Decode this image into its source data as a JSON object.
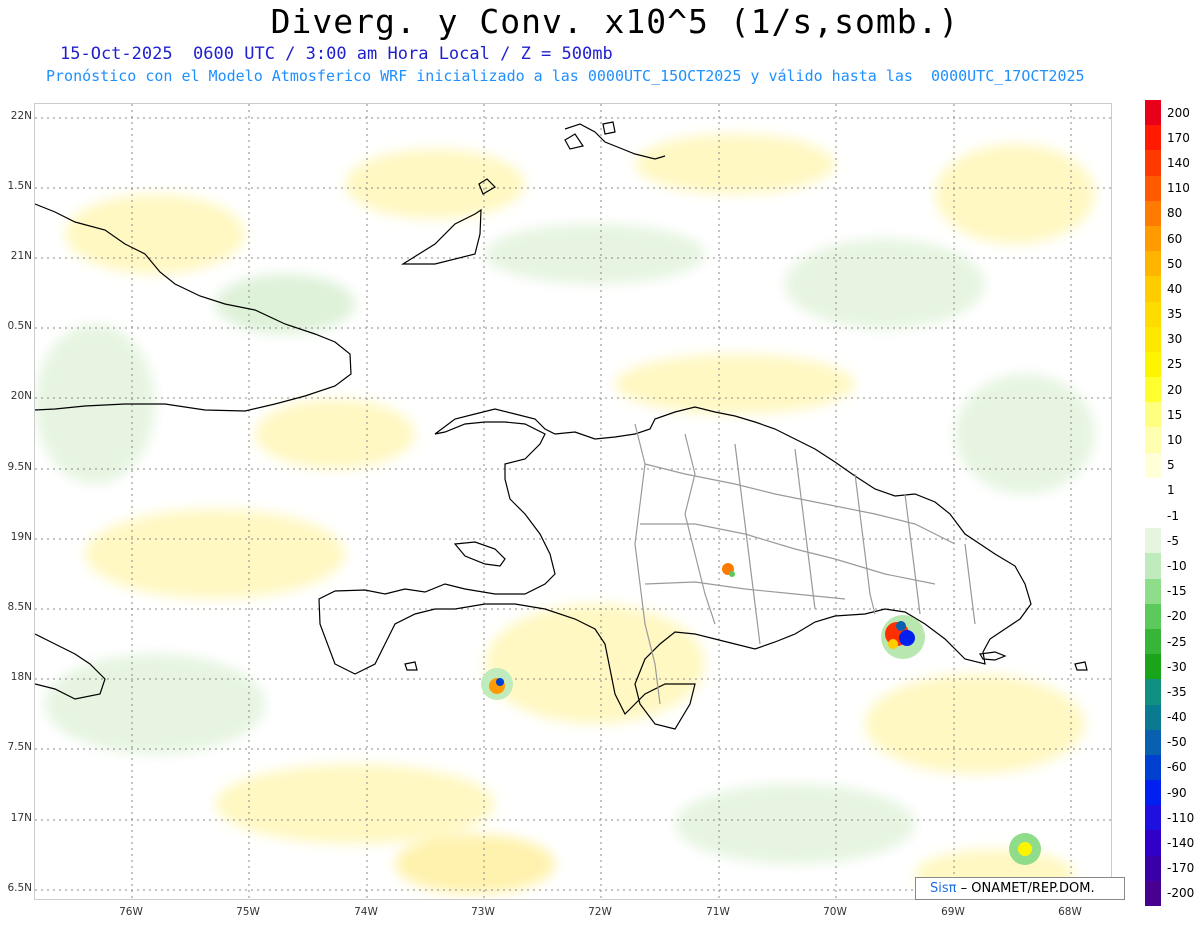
{
  "header": {
    "title": "Diverg. y Conv. x10^5 (1/s,somb.)",
    "subtitle1": "15-Oct-2025  0600 UTC / 3:00 am Hora Local / Z = 500mb",
    "subtitle2": "Pronóstico con el Modelo Atmosferico WRF inicializado a las 0000UTC_15OCT2025 y válido hasta las  0000UTC_17OCT2025"
  },
  "axes": {
    "lat_labels": [
      "22N",
      "1.5N",
      "21N",
      "0.5N",
      "20N",
      "9.5N",
      "19N",
      "8.5N",
      "18N",
      "7.5N",
      "17N",
      "6.5N"
    ],
    "lon_labels": [
      "76W",
      "75W",
      "74W",
      "73W",
      "72W",
      "71W",
      "70W",
      "69W",
      "68W"
    ]
  },
  "colorbar": {
    "labels": [
      "200",
      "170",
      "140",
      "110",
      "80",
      "60",
      "50",
      "40",
      "35",
      "30",
      "25",
      "20",
      "15",
      "10",
      "5",
      "1",
      "-1",
      "-5",
      "-10",
      "-15",
      "-20",
      "-25",
      "-30",
      "-35",
      "-40",
      "-50",
      "-60",
      "-90",
      "-110",
      "-140",
      "-170",
      "-200"
    ],
    "colors": [
      "#e8001a",
      "#ff1a00",
      "#ff3a00",
      "#ff5a00",
      "#ff7a00",
      "#ff9a00",
      "#ffb400",
      "#ffcc00",
      "#ffdc00",
      "#ffe800",
      "#fff400",
      "#ffff30",
      "#ffff80",
      "#ffffb0",
      "#ffffd8",
      "#ffffff",
      "#ffffff",
      "#e6f5e0",
      "#c0ecbd",
      "#8fdd8a",
      "#5cc95c",
      "#37b537",
      "#1aa41a",
      "#109080",
      "#0a7a90",
      "#0a60b0",
      "#0040d0",
      "#0020f0",
      "#2010e0",
      "#3000c8",
      "#3a00a8",
      "#480090"
    ]
  },
  "credit": {
    "logo_text": "Sisπ",
    "text": " – ONAMET/REP.DOM."
  }
}
